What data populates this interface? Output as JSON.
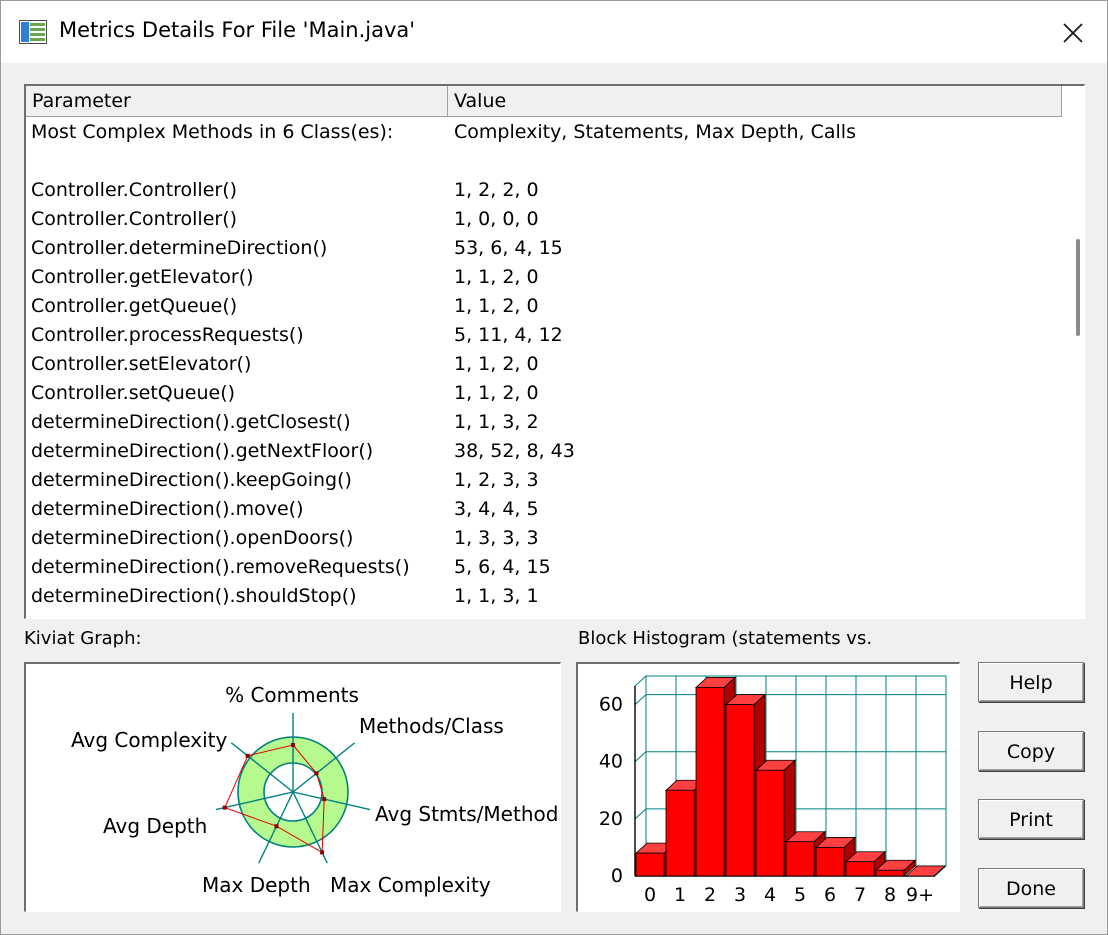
{
  "window": {
    "title": "Metrics Details For File 'Main.java'"
  },
  "table": {
    "columns": [
      "Parameter",
      "Value"
    ],
    "rows": [
      {
        "param": "Most Complex Methods in 6 Class(es):",
        "value": "Complexity, Statements, Max Depth, Calls"
      },
      {
        "param": "",
        "value": ""
      },
      {
        "param": "Controller.Controller()",
        "value": "1, 2, 2, 0"
      },
      {
        "param": "Controller.Controller()",
        "value": "1, 0, 0, 0"
      },
      {
        "param": "Controller.determineDirection()",
        "value": "53, 6, 4, 15"
      },
      {
        "param": "Controller.getElevator()",
        "value": "1, 1, 2, 0"
      },
      {
        "param": "Controller.getQueue()",
        "value": "1, 1, 2, 0"
      },
      {
        "param": "Controller.processRequests()",
        "value": "5, 11, 4, 12"
      },
      {
        "param": "Controller.setElevator()",
        "value": "1, 1, 2, 0"
      },
      {
        "param": "Controller.setQueue()",
        "value": "1, 1, 2, 0"
      },
      {
        "param": "determineDirection().getClosest()",
        "value": "1, 1, 3, 2"
      },
      {
        "param": "determineDirection().getNextFloor()",
        "value": "38, 52, 8, 43"
      },
      {
        "param": "determineDirection().keepGoing()",
        "value": "1, 2, 3, 3"
      },
      {
        "param": "determineDirection().move()",
        "value": "3, 4, 4, 5"
      },
      {
        "param": "determineDirection().openDoors()",
        "value": "1, 3, 3, 3"
      },
      {
        "param": "determineDirection().removeRequests()",
        "value": "5, 6, 4, 15"
      },
      {
        "param": "determineDirection().shouldStop()",
        "value": "1, 1, 3, 1"
      }
    ]
  },
  "kiviat": {
    "label": "Kiviat Graph:",
    "axes": [
      "% Comments",
      "Methods/Class",
      "Avg Stmts/Method",
      "Max Complexity",
      "Max Depth",
      "Avg Depth",
      "Avg Complexity"
    ],
    "colors": {
      "band": "#b6f98e",
      "ring": "#008080",
      "line": "#e00000"
    }
  },
  "histogram": {
    "label": "Block Histogram (statements vs.",
    "colors": {
      "bar": "#ff0000",
      "grid": "#008080"
    }
  },
  "chart_data": {
    "type": "bar",
    "categories": [
      "0",
      "1",
      "2",
      "3",
      "4",
      "5",
      "6",
      "7",
      "8",
      "9+"
    ],
    "values": [
      8,
      30,
      66,
      60,
      37,
      12,
      10,
      5,
      2,
      0
    ],
    "ylim": [
      0,
      70
    ],
    "yticks": [
      0,
      20,
      40,
      60
    ],
    "grid": true
  },
  "buttons": {
    "help": "Help",
    "copy": "Copy",
    "print": "Print",
    "done": "Done"
  }
}
